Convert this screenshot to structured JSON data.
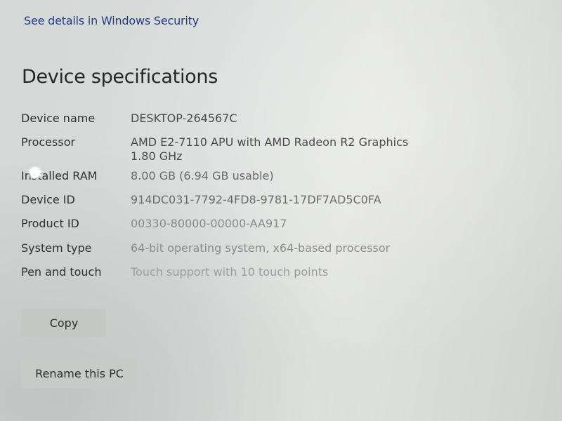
{
  "security_link": "See details in Windows Security",
  "title": "Device specifications",
  "specs": {
    "device_name": {
      "label": "Device name",
      "value": "DESKTOP-264567C"
    },
    "processor": {
      "label": "Processor",
      "value_line1": "AMD E2-7110 APU with AMD Radeon R2 Graphics",
      "value_line2": "1.80 GHz"
    },
    "installed_ram": {
      "label": "Installed RAM",
      "value": "8.00 GB (6.94 GB usable)"
    },
    "device_id": {
      "label": "Device ID",
      "value": "914DC031-7792-4FD8-9781-17DF7AD5C0FA"
    },
    "product_id": {
      "label": "Product ID",
      "value": "00330-80000-00000-AA917"
    },
    "system_type": {
      "label": "System type",
      "value": "64-bit operating system, x64-based processor"
    },
    "pen_touch": {
      "label": "Pen and touch",
      "value": "Touch support with 10 touch points"
    }
  },
  "buttons": {
    "copy": "Copy",
    "rename": "Rename this PC"
  },
  "colors": {
    "link": "#1f3c8a",
    "button_bg": "#c5c7c5"
  }
}
